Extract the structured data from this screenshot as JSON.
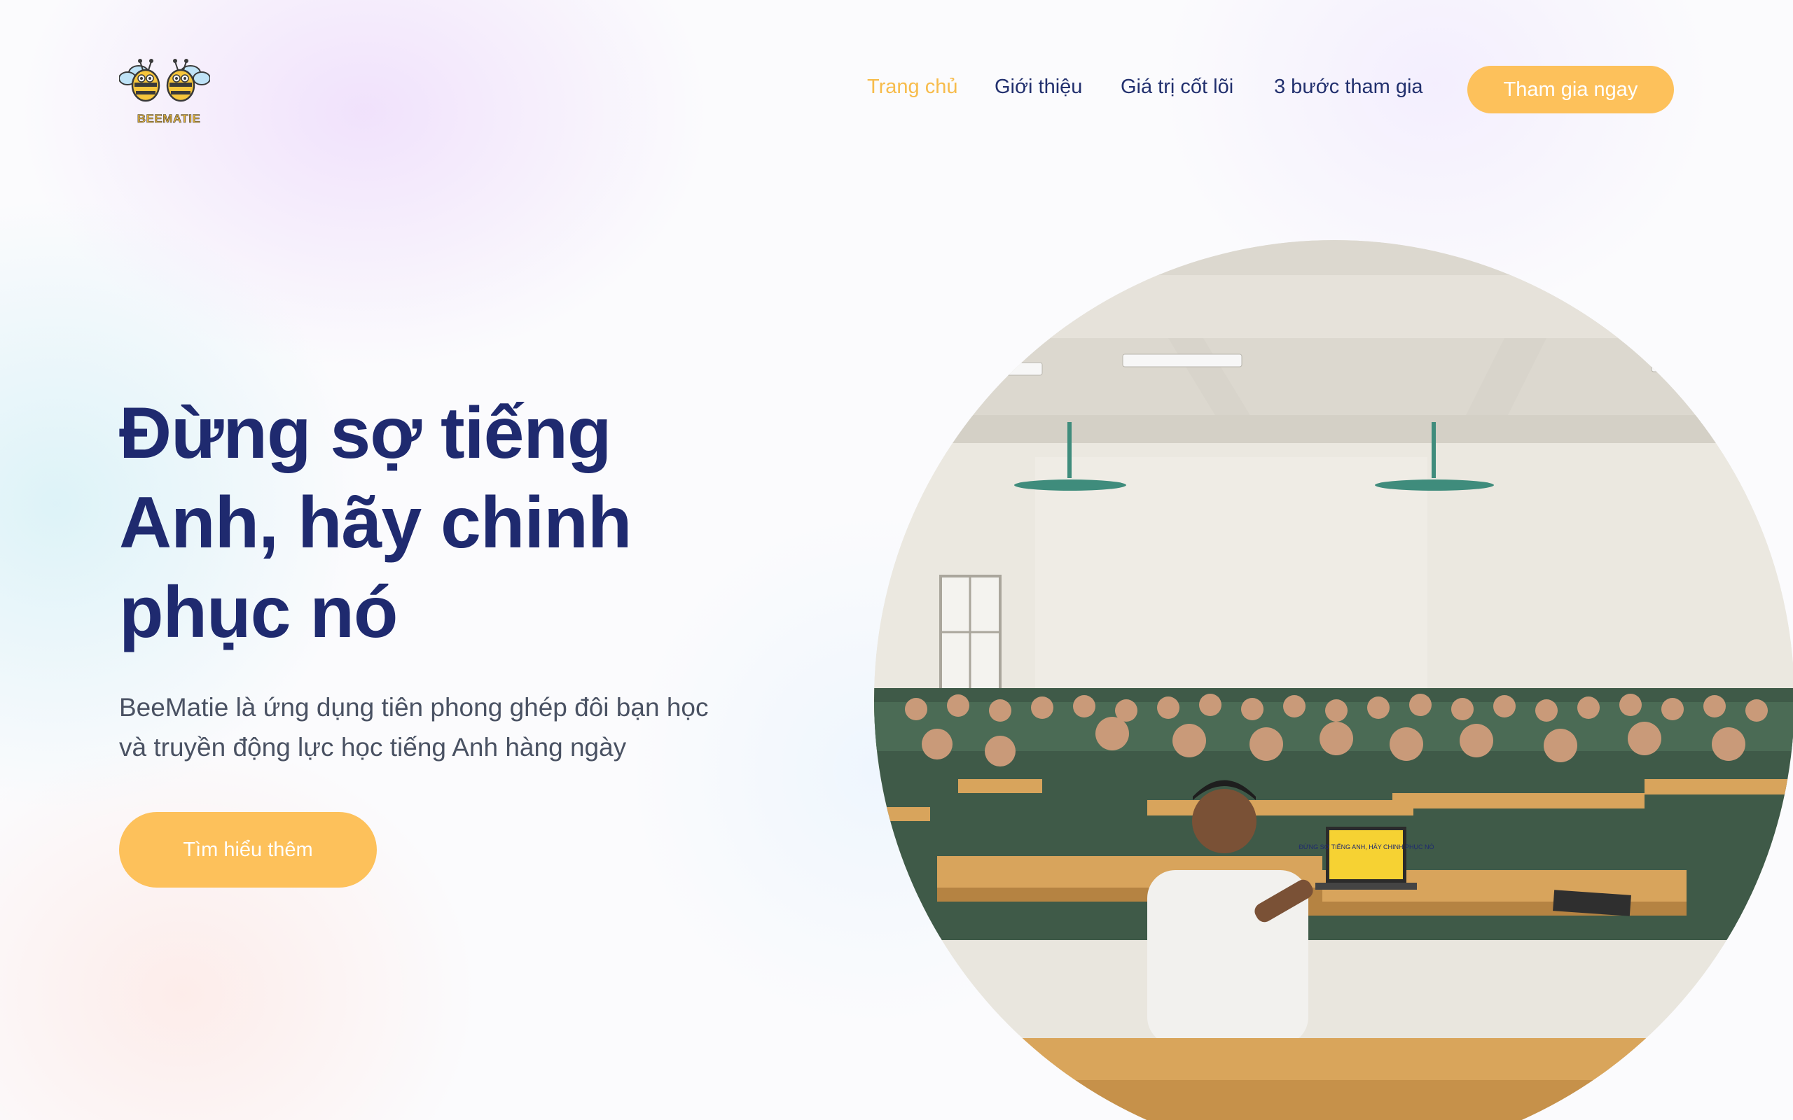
{
  "brand": {
    "logo_text": "BEEMATIE",
    "primary_color": "#1f2a6f",
    "accent_color": "#fdc15b"
  },
  "nav": {
    "items": [
      {
        "label": "Trang chủ",
        "active": true
      },
      {
        "label": "Giới thiệu",
        "active": false
      },
      {
        "label": "Giá trị cốt lõi",
        "active": false
      },
      {
        "label": "3 bước tham gia",
        "active": false
      }
    ],
    "cta_label": "Tham gia ngay"
  },
  "hero": {
    "title_lines": [
      "Đừng sợ tiếng",
      "Anh, hãy chinh",
      "phục nó"
    ],
    "subtitle_lines": [
      "BeeMatie là ứng dụng tiên phong ghép đôi bạn học",
      "và truyền động lực học tiếng Anh hàng ngày"
    ],
    "cta_label": "Tìm hiểu thêm"
  },
  "photo": {
    "laptop_screen_text": "ĐỪNG SỢ TIẾNG ANH, HÃY CHINH PHỤC NÓ"
  }
}
